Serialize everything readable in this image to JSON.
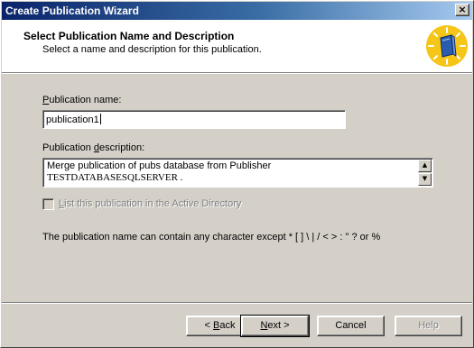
{
  "window": {
    "title": "Create Publication Wizard",
    "close_glyph": "×"
  },
  "header": {
    "title": "Select Publication Name and Description",
    "subtitle": "Select a name and description for this publication.",
    "icon": "wizard-book-icon"
  },
  "form": {
    "name_label_mnemonic": "P",
    "name_label_rest": "ublication name:",
    "name_value": "publication1",
    "desc_label_prefix": "Publication ",
    "desc_label_mnemonic": "d",
    "desc_label_rest": "escription:",
    "desc_line1": "Merge publication of pubs database from Publisher",
    "desc_line2": "TESTDATABASESQLSERVER .",
    "checkbox_label_mnemonic": "L",
    "checkbox_label_rest": "ist this publication in the Active Directory",
    "checkbox_checked": false,
    "checkbox_enabled": false,
    "note": "The publication name can contain any character except * [ ] \\ | / < > : \" ? or %"
  },
  "buttons": {
    "back_prefix": "< ",
    "back_mnemonic": "B",
    "back_rest": "ack",
    "next_mnemonic": "N",
    "next_rest": "ext >",
    "cancel": "Cancel",
    "help": "Help"
  },
  "colors": {
    "titlebar_start": "#0a246a",
    "titlebar_end": "#a6caf0",
    "face": "#d4d0c8",
    "icon_circle": "#f5c518"
  }
}
